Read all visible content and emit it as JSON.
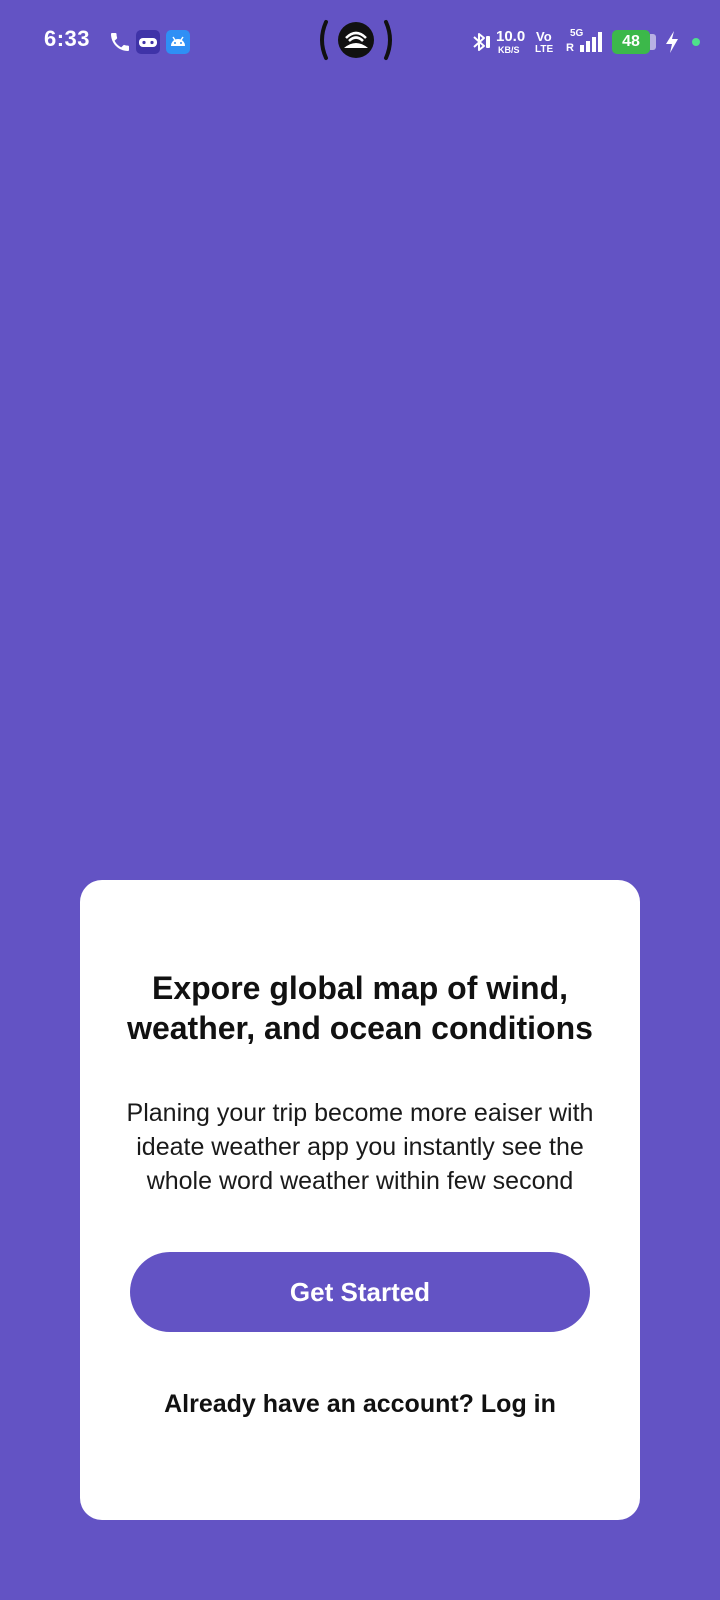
{
  "status_bar": {
    "time": "6:33",
    "network_speed_value": "10.0",
    "network_speed_unit": "KB/S",
    "volte_top": "Vo",
    "volte_bottom": "LTE",
    "network_type": "5G",
    "roaming": "R",
    "battery_level": "48",
    "icons": [
      "phone-icon",
      "game-controller-icon",
      "android-icon",
      "hotspot-icon",
      "bluetooth-icon",
      "signal-icon",
      "charging-icon"
    ]
  },
  "onboarding": {
    "title_line1": "Expore global map of wind,",
    "title_line2": "weather, and ocean conditions",
    "desc_line1": "Planing your trip become more eaiser with",
    "desc_line2": "ideate weather app you instantly see the",
    "desc_line3": "whole word weather within few second",
    "get_started_label": "Get Started",
    "login_prompt": "Already have an account? Log in"
  },
  "colors": {
    "background": "#6353c4",
    "card": "#ffffff",
    "button": "#6353c4",
    "battery": "#3cb84a"
  }
}
